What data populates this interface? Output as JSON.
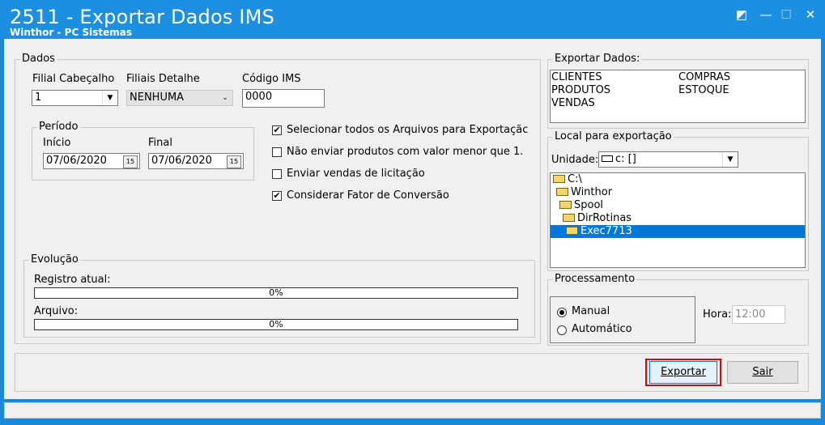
{
  "window": {
    "title": "2511 - Exportar Dados IMS",
    "subtitle": "Winthor - PC Sistemas",
    "controls": [
      "◩",
      "—",
      "☐",
      "✕"
    ]
  },
  "dados": {
    "legend": "Dados",
    "filial_cabecalho": {
      "label": "Filial Cabeçalho",
      "value": "1"
    },
    "filiais_detalhe": {
      "label": "Filiais Detalhe",
      "value": "NENHUMA"
    },
    "codigo_ims": {
      "label": "Código IMS",
      "value": "0000"
    },
    "periodo": {
      "legend": "Período",
      "inicio": {
        "label": "Início",
        "value": "07/06/2020"
      },
      "final": {
        "label": "Final",
        "value": "07/06/2020"
      },
      "calendar_glyph": "15"
    },
    "options": [
      {
        "label": "Selecionar todos os Arquivos para Exportaçãc",
        "checked": true
      },
      {
        "label": "Não enviar produtos com valor menor que 1.",
        "checked": false
      },
      {
        "label": "Enviar vendas de licitação",
        "checked": false
      },
      {
        "label": "Considerar Fator de Conversão",
        "checked": true
      }
    ],
    "check_glyph": "✔"
  },
  "evolucao": {
    "legend": "Evolução",
    "registro_label": "Registro atual:",
    "registro_value": "0%",
    "arquivo_label": "Arquivo:",
    "arquivo_value": "0%"
  },
  "exportar_dados": {
    "legend": "Exportar Dados:",
    "col1": [
      "CLIENTES",
      "PRODUTOS",
      "VENDAS"
    ],
    "col2": [
      "COMPRAS",
      "ESTOQUE"
    ]
  },
  "local": {
    "legend": "Local para exportação",
    "unidade_label": "Unidade:",
    "unidade_value": "c: []",
    "tree": [
      "C:\\",
      "Winthor",
      "Spool",
      "DirRotinas",
      "Exec7713"
    ]
  },
  "processamento": {
    "legend": "Processamento",
    "manual": "Manual",
    "automatico": "Automático",
    "selected": "Manual",
    "hora_label": "Hora:",
    "hora_value": "12:00"
  },
  "buttons": {
    "exportar": "Exportar",
    "sair": "Sair"
  },
  "colors": {
    "titlebar": "#1c8fe0",
    "selection": "#0078d7",
    "highlight_border": "#e00000"
  }
}
